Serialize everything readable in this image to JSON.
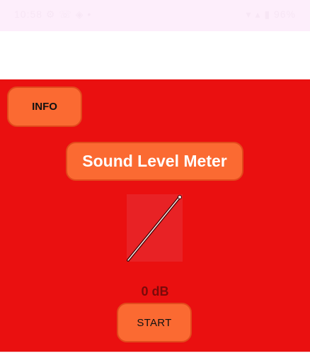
{
  "status_bar": {
    "left_text": "10:58 ⚙ ☏ ◈ •",
    "right_text": "▾ ▴ ▮ 96%"
  },
  "app": {
    "info_label": "INFO",
    "title_label": "Sound Level Meter",
    "db_value": 0,
    "db_unit": "dB",
    "db_reading": "0 dB",
    "start_label": "START"
  },
  "colors": {
    "panel_red": "#ea1010",
    "button_orange": "#fb6a32",
    "reading_text": "#7a0a0a"
  },
  "icons": {
    "gauge": "needle-gauge-icon"
  }
}
